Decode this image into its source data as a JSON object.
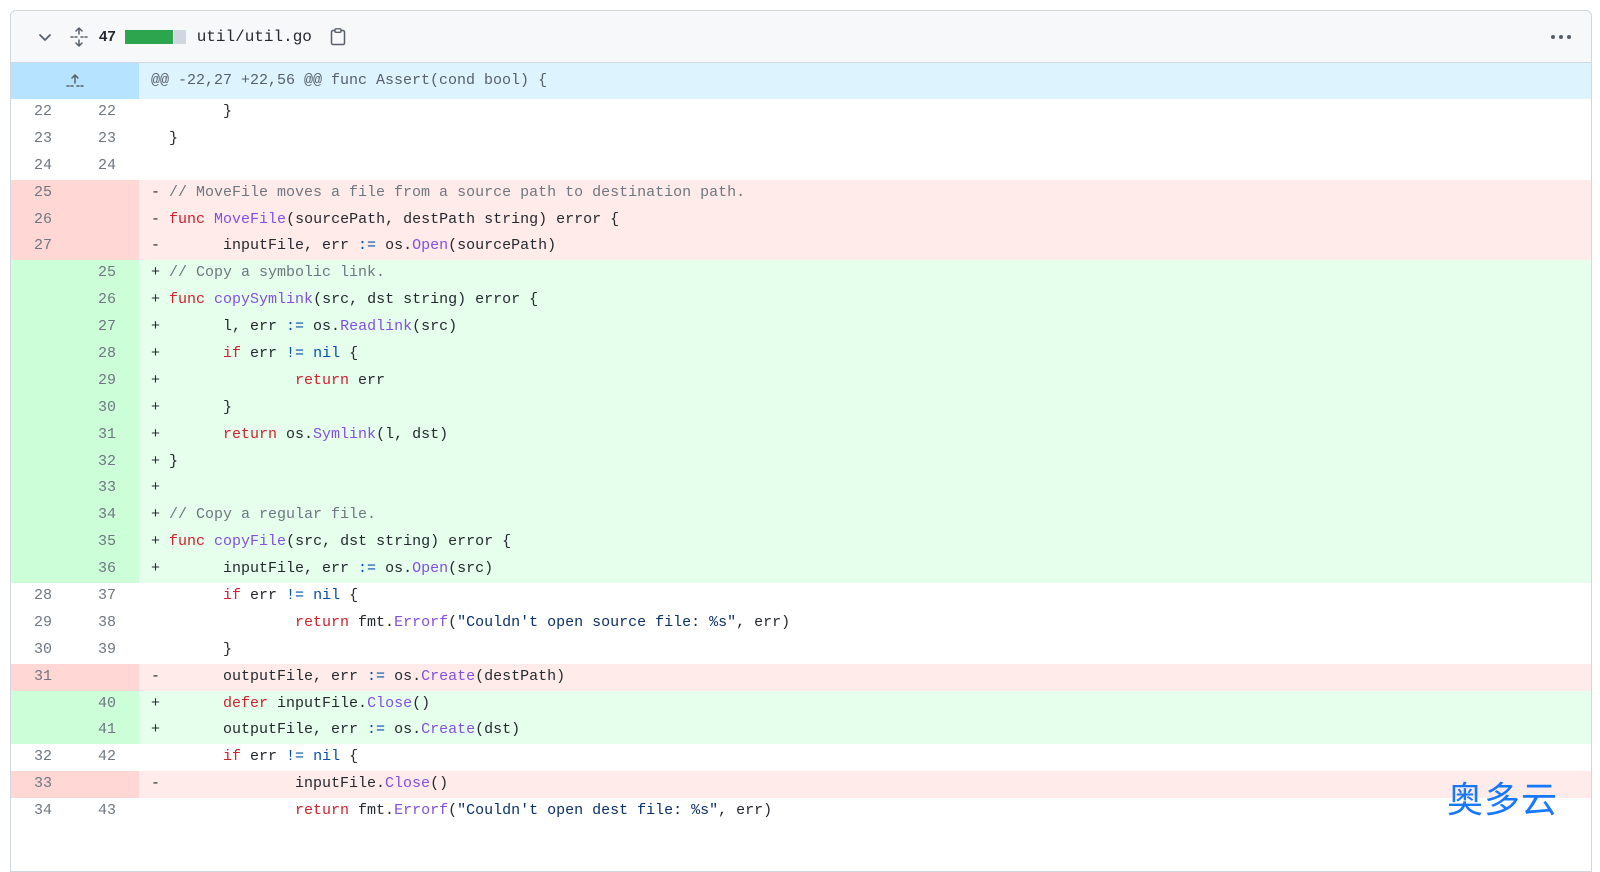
{
  "file": {
    "changes": "47",
    "name": "util/util.go"
  },
  "hunk": "@@ -22,27 +22,56 @@ func Assert(cond bool) {",
  "lines": [
    {
      "t": "ctx",
      "o": "22",
      "n": "22",
      "code": "        }"
    },
    {
      "t": "ctx",
      "o": "23",
      "n": "23",
      "code": "  }"
    },
    {
      "t": "ctx",
      "o": "24",
      "n": "24",
      "code": ""
    },
    {
      "t": "del",
      "o": "25",
      "n": "",
      "code": "- // MoveFile moves a file from a source path to destination path."
    },
    {
      "t": "del",
      "o": "26",
      "n": "",
      "code": "- func MoveFile(sourcePath, destPath string) error {"
    },
    {
      "t": "del",
      "o": "27",
      "n": "",
      "code": "-       inputFile, err := os.Open(sourcePath)"
    },
    {
      "t": "add",
      "o": "",
      "n": "25",
      "code": "+ // Copy a symbolic link."
    },
    {
      "t": "add",
      "o": "",
      "n": "26",
      "code": "+ func copySymlink(src, dst string) error {"
    },
    {
      "t": "add",
      "o": "",
      "n": "27",
      "code": "+       l, err := os.Readlink(src)"
    },
    {
      "t": "add",
      "o": "",
      "n": "28",
      "code": "+       if err != nil {"
    },
    {
      "t": "add",
      "o": "",
      "n": "29",
      "code": "+               return err"
    },
    {
      "t": "add",
      "o": "",
      "n": "30",
      "code": "+       }"
    },
    {
      "t": "add",
      "o": "",
      "n": "31",
      "code": "+       return os.Symlink(l, dst)"
    },
    {
      "t": "add",
      "o": "",
      "n": "32",
      "code": "+ }"
    },
    {
      "t": "add",
      "o": "",
      "n": "33",
      "code": "+"
    },
    {
      "t": "add",
      "o": "",
      "n": "34",
      "code": "+ // Copy a regular file."
    },
    {
      "t": "add",
      "o": "",
      "n": "35",
      "code": "+ func copyFile(src, dst string) error {"
    },
    {
      "t": "add",
      "o": "",
      "n": "36",
      "code": "+       inputFile, err := os.Open(src)"
    },
    {
      "t": "ctx",
      "o": "28",
      "n": "37",
      "code": "        if err != nil {"
    },
    {
      "t": "ctx",
      "o": "29",
      "n": "38",
      "code": "                return fmt.Errorf(\"Couldn't open source file: %s\", err)"
    },
    {
      "t": "ctx",
      "o": "30",
      "n": "39",
      "code": "        }"
    },
    {
      "t": "del",
      "o": "31",
      "n": "",
      "code": "-       outputFile, err := os.Create(destPath)"
    },
    {
      "t": "add",
      "o": "",
      "n": "40",
      "code": "+       defer inputFile.Close()"
    },
    {
      "t": "add",
      "o": "",
      "n": "41",
      "code": "+       outputFile, err := os.Create(dst)"
    },
    {
      "t": "ctx",
      "o": "32",
      "n": "42",
      "code": "        if err != nil {"
    },
    {
      "t": "del",
      "o": "33",
      "n": "",
      "code": "-               inputFile.Close()"
    },
    {
      "t": "ctx",
      "o": "34",
      "n": "43",
      "code": "                return fmt.Errorf(\"Couldn't open dest file: %s\", err)"
    }
  ],
  "watermark": "奥多云",
  "colors": {
    "add_bg": "#e6ffec",
    "del_bg": "#ffebe9",
    "hunk_bg": "#ddf4ff",
    "diffstat_add": "#2da44e"
  },
  "icons": {
    "collapse": "chevron-down-icon",
    "expand": "unfold-icon",
    "copy": "copy-icon",
    "more": "kebab-horizontal-icon",
    "expand_up": "fold-up-icon"
  }
}
